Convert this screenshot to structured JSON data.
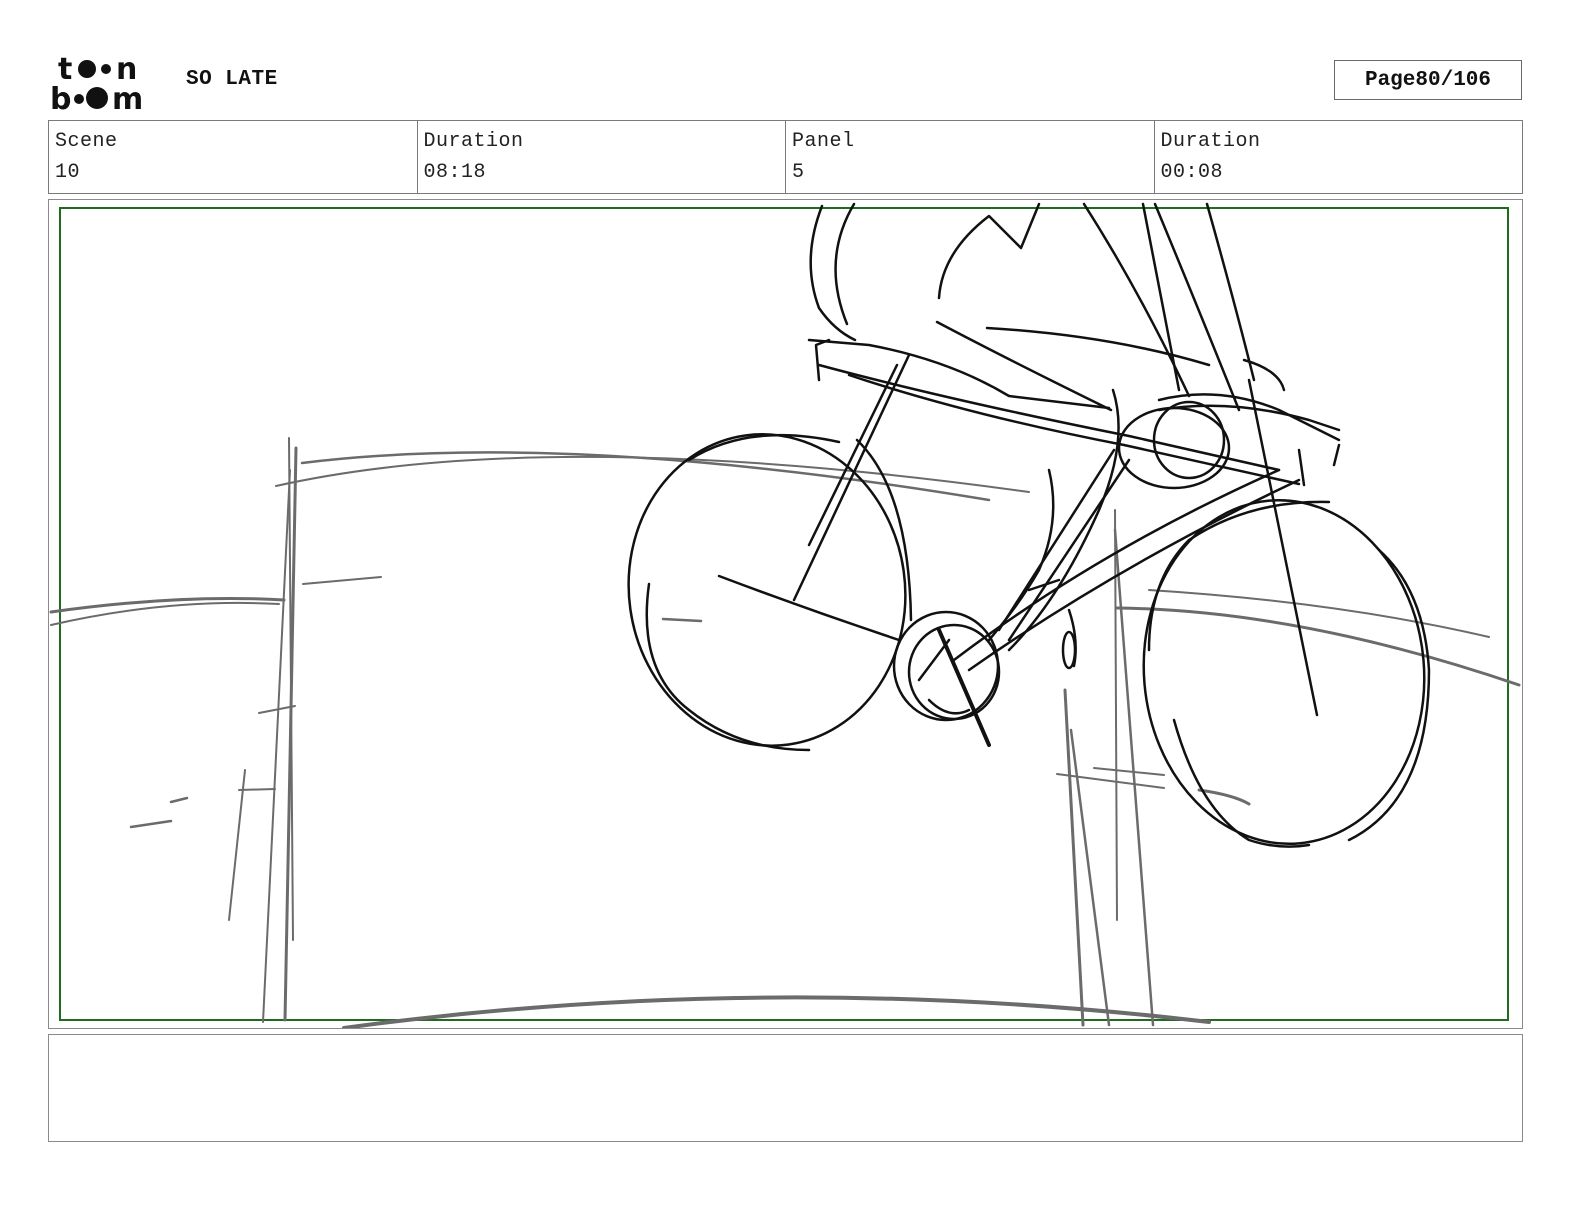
{
  "header": {
    "logo_text": "toon boom",
    "project_title": "SO LATE",
    "page_label": "Page",
    "page_number": "80/106"
  },
  "info": {
    "scene_label": "Scene",
    "scene_value": "10",
    "scene_duration_label": "Duration",
    "scene_duration_value": "08:18",
    "panel_label": "Panel",
    "panel_value": "5",
    "panel_duration_label": "Duration",
    "panel_duration_value": "00:08"
  },
  "panel": {
    "safe_frame_color": "#1f6b1f",
    "line_dark": "#111111",
    "line_grey": "#6b6b6b"
  },
  "notes": {
    "text": ""
  }
}
